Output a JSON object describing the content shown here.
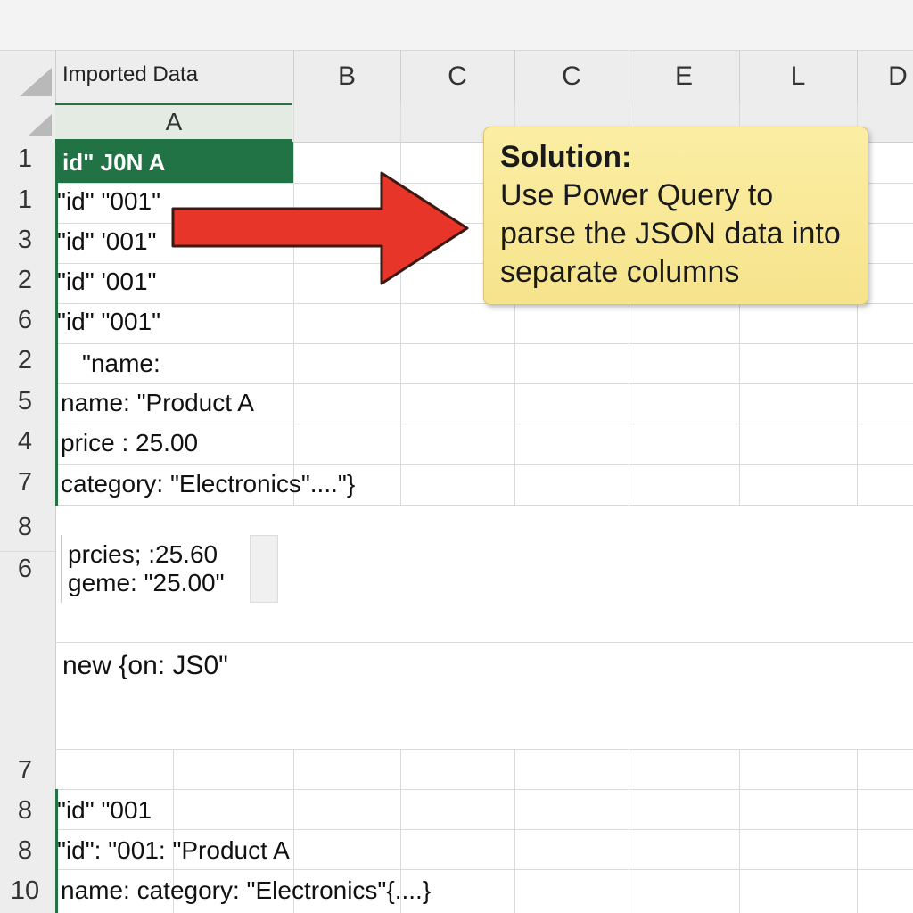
{
  "sheet": {
    "imported_label": "Imported Data",
    "columns": [
      "B",
      "C",
      "C",
      "E",
      "L",
      "D"
    ],
    "column_a": "A",
    "header_cell": "id\" J0N A",
    "rows": [
      {
        "num": "1",
        "text": "\"id\" \"001\""
      },
      {
        "num": "3",
        "text": "\"id\" '001\""
      },
      {
        "num": "2",
        "text": "\"id\" '001\""
      },
      {
        "num": "6",
        "text": "\"id\" \"001\""
      },
      {
        "num": "2",
        "text": "\"name:"
      },
      {
        "num": "5",
        "text": "name: \"Product A"
      },
      {
        "num": "4",
        "text": "price : 25.00"
      },
      {
        "num": "7",
        "text": "category: \"Electronics\"....\"}"
      }
    ],
    "header_row_num": "1",
    "row_num_8a": "8",
    "row_num_6b": "6",
    "sample_line1": "prcies; :25.60",
    "sample_line2": "geme: \"25.00\"",
    "new_line": "new {on: JS0\"",
    "row_num_7b": "7",
    "bottom_rows": [
      {
        "num": "8",
        "text": "\"id\" \"001"
      },
      {
        "num": "8",
        "text": "\"id\": \"001: \"Product A"
      },
      {
        "num": "10",
        "text": "name: category: \"Electronics\"{....}"
      }
    ]
  },
  "callout": {
    "title": "Solution:",
    "body": "Use Power Query to parse the JSON data into separate columns"
  },
  "colors": {
    "accent_green": "#217346",
    "arrow_red": "#e8352a",
    "callout_yellow": "#f8e79a"
  },
  "icons": [
    "select-all-triangle-icon",
    "arrow-right-icon"
  ]
}
